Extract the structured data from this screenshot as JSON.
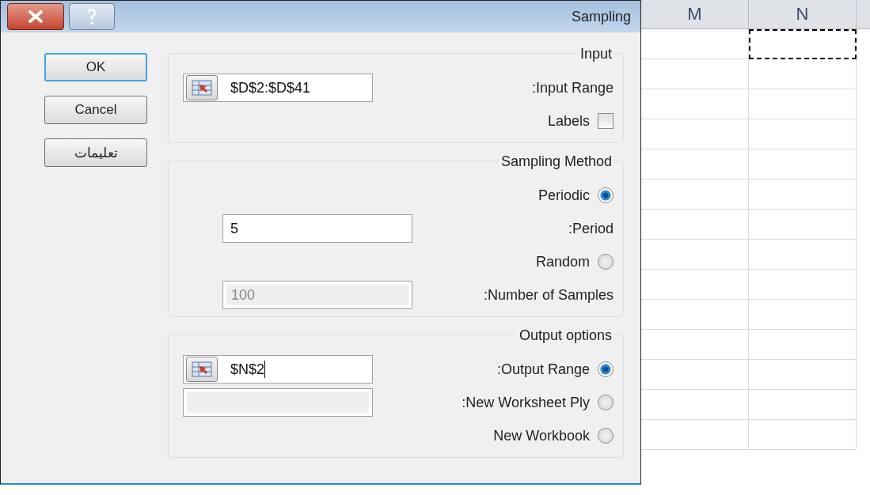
{
  "dialog": {
    "title": "Sampling",
    "buttons": [
      {
        "label": "OK",
        "default": true
      },
      {
        "label": "Cancel",
        "default": false
      },
      {
        "label": "تعليمات",
        "default": false
      }
    ],
    "groups": [
      {
        "legend": "Input",
        "rows": [
          {
            "kind": "field",
            "label": ":Input Range",
            "value": "$D$2:$D$41",
            "ref_button": true
          },
          {
            "kind": "checkbox",
            "label": "Labels",
            "checked": false
          }
        ]
      },
      {
        "legend": "Sampling Method",
        "rows": [
          {
            "kind": "radio",
            "label": "Periodic",
            "selected": true
          },
          {
            "kind": "field",
            "label": ":Period",
            "value": "5",
            "ref_button": false
          },
          {
            "kind": "radio",
            "label": "Random",
            "selected": false
          },
          {
            "kind": "field",
            "label": ":Number of Samples",
            "value": "100",
            "ref_button": false,
            "disabled": true
          }
        ]
      },
      {
        "legend": "Output options",
        "rows": [
          {
            "kind": "radio_field",
            "label": ":Output Range",
            "selected": true,
            "value": "$N$2",
            "ref_button": true,
            "disabled": false
          },
          {
            "kind": "radio_field",
            "label": ":New Worksheet Ply",
            "selected": false,
            "ref_button": false,
            "disabled": true
          },
          {
            "kind": "radio",
            "label": "New Workbook",
            "selected": false
          }
        ]
      }
    ]
  },
  "sheet": {
    "columns": [
      {
        "label": "M",
        "marquee": false
      },
      {
        "label": "N",
        "marquee": true
      }
    ]
  }
}
